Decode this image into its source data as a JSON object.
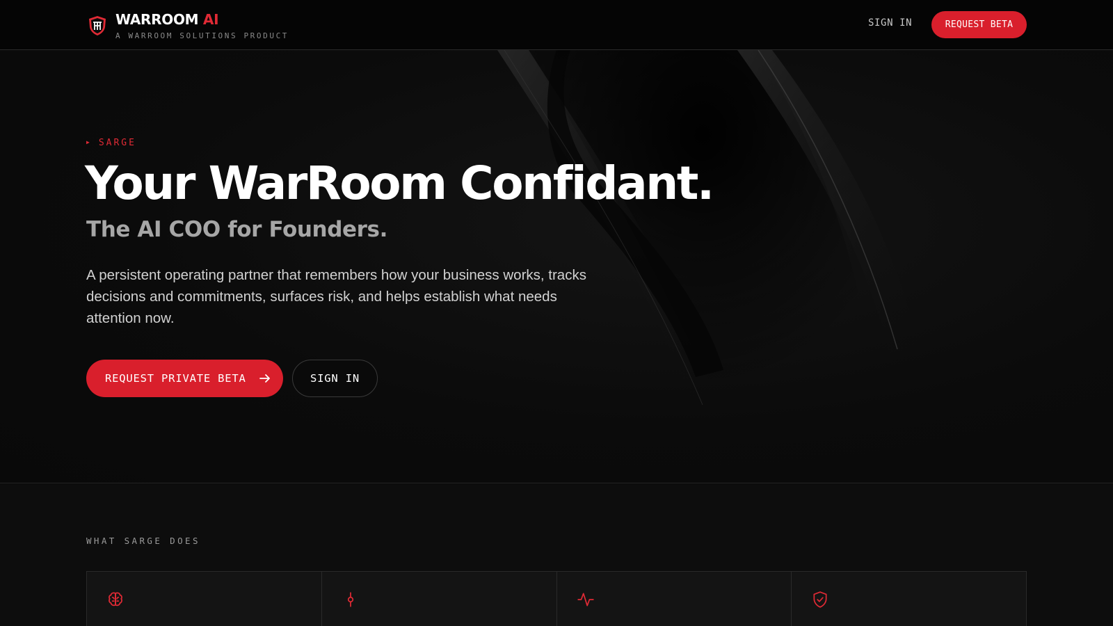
{
  "header": {
    "brand_name": "WARROOM",
    "brand_accent": "AI",
    "brand_tagline": "A WARROOM SOLUTIONS PRODUCT",
    "logo_icon": "shield-crest-icon",
    "nav": {
      "sign_in_label": "SIGN IN",
      "request_beta_label": "REQUEST BETA"
    }
  },
  "hero": {
    "eyebrow": "SARGE",
    "headline": "Your WarRoom Confidant.",
    "subheadline": "The AI COO for Founders.",
    "description": "A persistent operating partner that remembers how your business works, tracks decisions and commitments, surfaces risk, and helps establish what needs attention now.",
    "primary_cta": "REQUEST PRIVATE BETA",
    "secondary_cta": "SIGN IN"
  },
  "features": {
    "section_label": "WHAT SARGE DOES",
    "cards": [
      {
        "icon": "brain-icon",
        "title": ""
      },
      {
        "icon": "commit-icon",
        "title": ""
      },
      {
        "icon": "activity-icon",
        "title": ""
      },
      {
        "icon": "shield-check-icon",
        "title": ""
      }
    ]
  },
  "colors": {
    "accent": "#d91f2c",
    "background": "#0a0a0a",
    "text_primary": "#ffffff",
    "text_muted": "#a6a6a6"
  }
}
